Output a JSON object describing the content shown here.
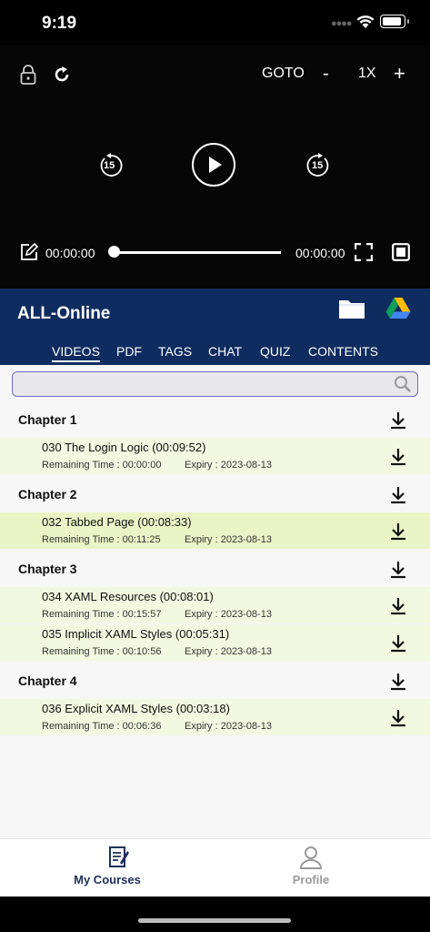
{
  "status_bar": {
    "time": "9:19"
  },
  "player": {
    "goto_label": "GOTO",
    "speed_minus": "-",
    "speed": "1X",
    "speed_plus": "+",
    "skip_back": "15",
    "skip_forward": "15",
    "current_time": "00:00:00",
    "total_time": "00:00:00",
    "progress": 0
  },
  "header": {
    "title": "ALL-Online",
    "tabs": [
      "VIDEOS",
      "PDF",
      "TAGS",
      "CHAT",
      "QUIZ",
      "CONTENTS"
    ],
    "active_tab": "VIDEOS"
  },
  "search": {
    "placeholder": ""
  },
  "chapters": [
    {
      "label": "Chapter 1",
      "lessons": [
        {
          "title": "030 The Login Logic (00:09:52)",
          "remaining": "Remaining Time : 00:00:00",
          "expiry": "Expiry : 2023-08-13"
        }
      ]
    },
    {
      "label": "Chapter 2",
      "lessons": [
        {
          "title": "032 Tabbed Page (00:08:33)",
          "remaining": "Remaining Time : 00:11:25",
          "expiry": "Expiry : 2023-08-13"
        }
      ]
    },
    {
      "label": "Chapter 3",
      "lessons": [
        {
          "title": "034 XAML Resources (00:08:01)",
          "remaining": "Remaining Time : 00:15:57",
          "expiry": "Expiry : 2023-08-13"
        },
        {
          "title": "035 Implicit XAML Styles (00:05:31)",
          "remaining": "Remaining Time : 00:10:56",
          "expiry": "Expiry : 2023-08-13"
        }
      ]
    },
    {
      "label": "Chapter 4",
      "lessons": [
        {
          "title": "036 Explicit XAML Styles (00:03:18)",
          "remaining": "Remaining Time : 00:06:36",
          "expiry": "Expiry : 2023-08-13"
        }
      ]
    }
  ],
  "tab_bar": {
    "my_courses": "My Courses",
    "profile": "Profile",
    "active_color": "#1f2f5c",
    "inactive_color": "#9a9a9a"
  },
  "colors": {
    "header_bg": "#0f2c60",
    "selected_row": "#e9f5c6",
    "row_bg": "#f3f8e0"
  }
}
